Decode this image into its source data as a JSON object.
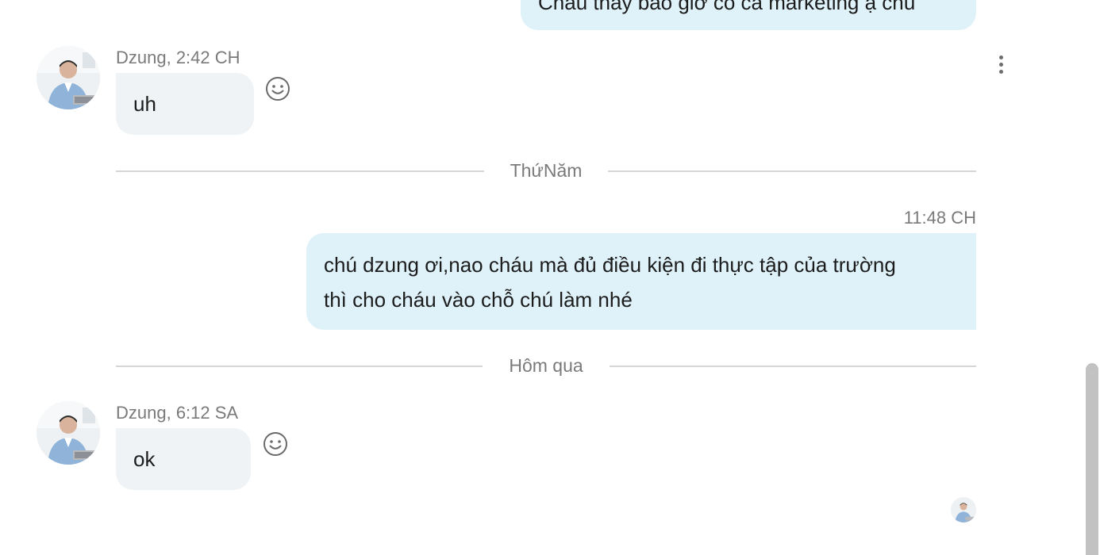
{
  "messages": {
    "m0": {
      "text": "Cháu thấy bao giờ có cả marketing ạ chú"
    },
    "m1": {
      "meta": "Dzung, 2:42 CH",
      "text": "uh"
    },
    "d1": {
      "label": "ThứNăm"
    },
    "m2": {
      "meta": "11:48 CH",
      "line1": "chú dzung ơi,nao cháu mà đủ điều kiện đi thực tập của trường",
      "line2": "thì cho cháu vào chỗ chú làm nhé"
    },
    "d2": {
      "label": "Hôm qua"
    },
    "m3": {
      "meta": "Dzung, 6:12 SA",
      "text": "ok"
    }
  },
  "icons": {
    "emoji": "smiley-face-icon",
    "more": "vertical-ellipsis-icon"
  },
  "colors": {
    "outgoing_bubble": "#dff2fa",
    "incoming_bubble": "#f0f3f6",
    "meta_text": "#7a7a7a",
    "divider": "#d6d6d6"
  }
}
